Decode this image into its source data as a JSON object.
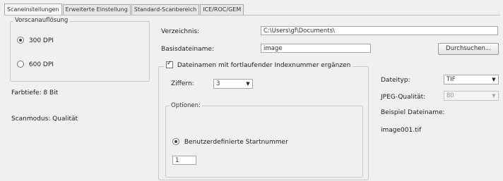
{
  "tabs": [
    {
      "label": "Scaneinstellungen"
    },
    {
      "label": "Erweiterte Einstellung"
    },
    {
      "label": "Standard-Scanbereich"
    },
    {
      "label": "ICE/ROC/GEM"
    }
  ],
  "resolution": {
    "title": "Vorscanauflösung",
    "options": [
      {
        "label": "300 DPI",
        "selected": true
      },
      {
        "label": "600 DPI",
        "selected": false
      }
    ]
  },
  "color_depth": "Farbtiefe: 8 Bit",
  "scan_mode": "Scanmodus: Qualität",
  "file": {
    "directory_label": "Verzeichnis:",
    "directory_value": "C:\\Users\\gf\\Documents\\",
    "basename_label": "Basisdateiname:",
    "basename_value": "image",
    "browse_label": "Durchsuchen..."
  },
  "indexing": {
    "checkbox_label": "Dateinamen mit fortlaufender Indexnummer ergänzen",
    "checked": true,
    "digits_label": "Ziffern:",
    "digits_value": "3",
    "options_title": "Optionen:",
    "custom_start_label": "Benutzerdefinierte Startnummer",
    "custom_start_selected": true,
    "start_value": "1"
  },
  "filetype": {
    "label": "Dateityp:",
    "value": "TIF",
    "jpeg_label": "JPEG-Qualität:",
    "jpeg_value": "80",
    "example_label": "Beispiel Dateiname:",
    "example_value": "image001.tif"
  }
}
